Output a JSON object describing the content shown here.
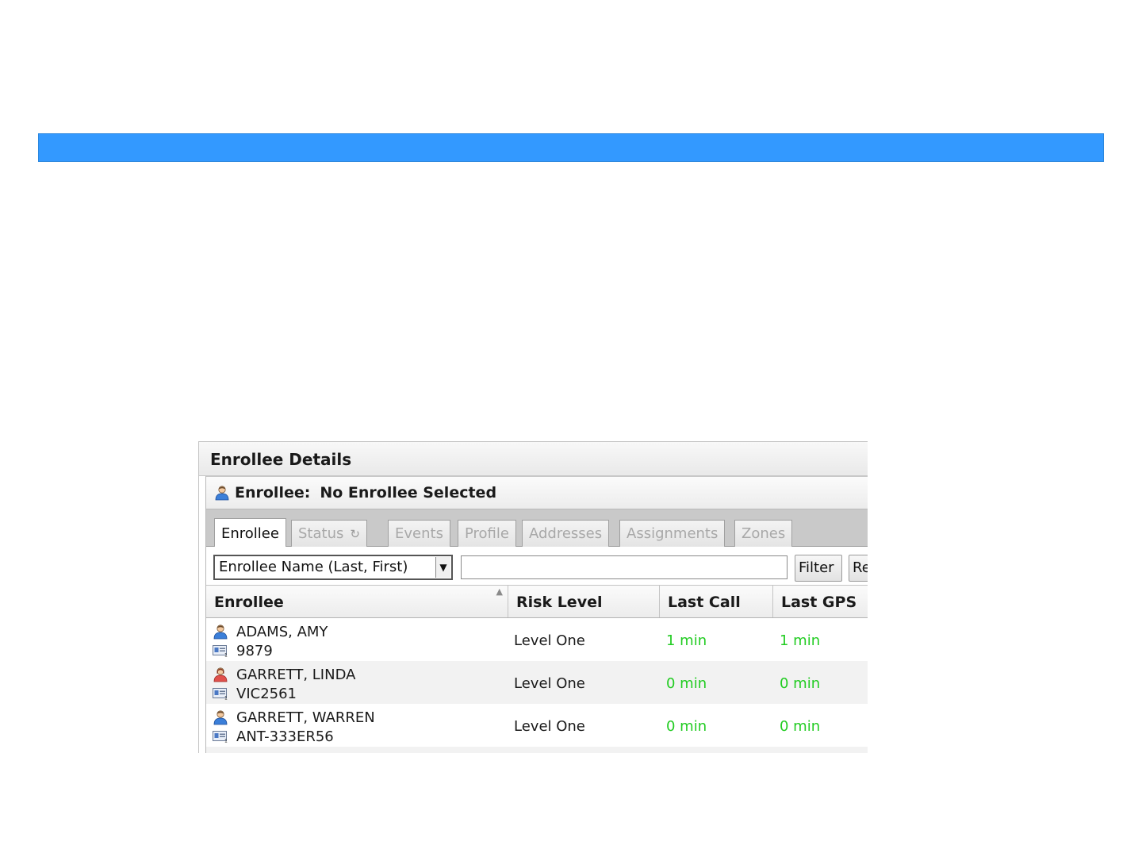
{
  "panel": {
    "title": "Enrollee Details",
    "enrollee_label": "Enrollee:",
    "enrollee_value": "No Enrollee Selected"
  },
  "tabs": [
    {
      "label": "Enrollee",
      "active": true
    },
    {
      "label": "Status",
      "active": false,
      "icon": "refresh-icon"
    },
    {
      "label": "Events",
      "active": false
    },
    {
      "label": "Profile",
      "active": false
    },
    {
      "label": "Addresses",
      "active": false
    },
    {
      "label": "Assignments",
      "active": false
    },
    {
      "label": "Zones",
      "active": false
    }
  ],
  "filter": {
    "select_value": "Enrollee Name (Last, First)",
    "input_value": "",
    "filter_label": "Filter",
    "reset_label": "Re"
  },
  "columns": [
    "Enrollee",
    "Risk Level",
    "Last Call",
    "Last GPS"
  ],
  "rows": [
    {
      "name": "ADAMS, AMY",
      "id": "9879",
      "risk": "Level One",
      "last_call": "1 min",
      "last_gps": "1 min",
      "icon": "male-person-icon"
    },
    {
      "name": "GARRETT, LINDA",
      "id": "VIC2561",
      "risk": "Level One",
      "last_call": "0 min",
      "last_gps": "0 min",
      "icon": "female-person-icon"
    },
    {
      "name": "GARRETT, WARREN",
      "id": "ANT-333ER56",
      "risk": "Level One",
      "last_call": "0 min",
      "last_gps": "0 min",
      "icon": "male-person-icon"
    }
  ],
  "colors": {
    "banner": "#3399ff",
    "time_ok": "#22cc22",
    "male_icon": "#3b7fd9",
    "female_icon": "#e0504b"
  }
}
